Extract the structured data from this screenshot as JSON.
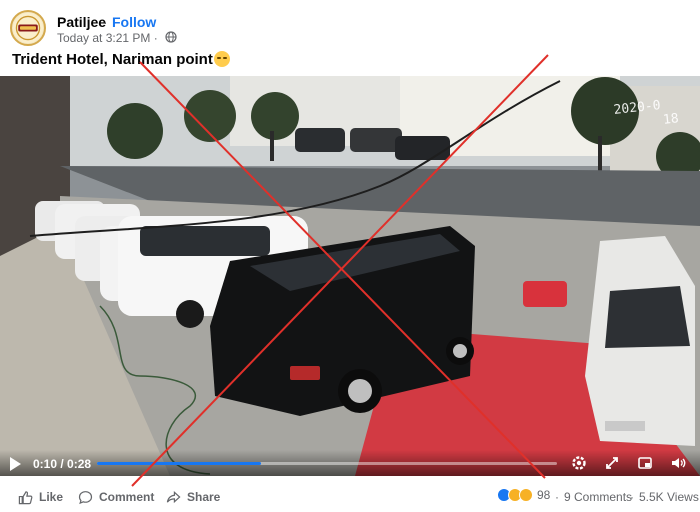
{
  "header": {
    "author": "Patiljee",
    "separator": "·",
    "follow_label": "Follow",
    "timestamp": "Today at 3:21 PM · ",
    "globe_icon": "globe-icon"
  },
  "post": {
    "caption": "Trident Hotel, Nariman point"
  },
  "video": {
    "watermark": "2020-0",
    "watermark_tail": "18",
    "current_time": "0:10",
    "time_separator": "/",
    "duration": "0:28",
    "time_display": "0:10 / 0:28",
    "progress": 0.357,
    "progress_color": "#1877f2",
    "icons": [
      "play-icon",
      "settings-icon",
      "fullscreen-icon",
      "pip-icon",
      "volume-icon"
    ]
  },
  "overlay": {
    "x_color": "#e0302a"
  },
  "footer": {
    "like_label": "Like",
    "comment_label": "Comment",
    "share_label": "Share",
    "reaction_count": "98",
    "separator": "·",
    "comments": "9 Comments",
    "views": "5.5K Views"
  }
}
